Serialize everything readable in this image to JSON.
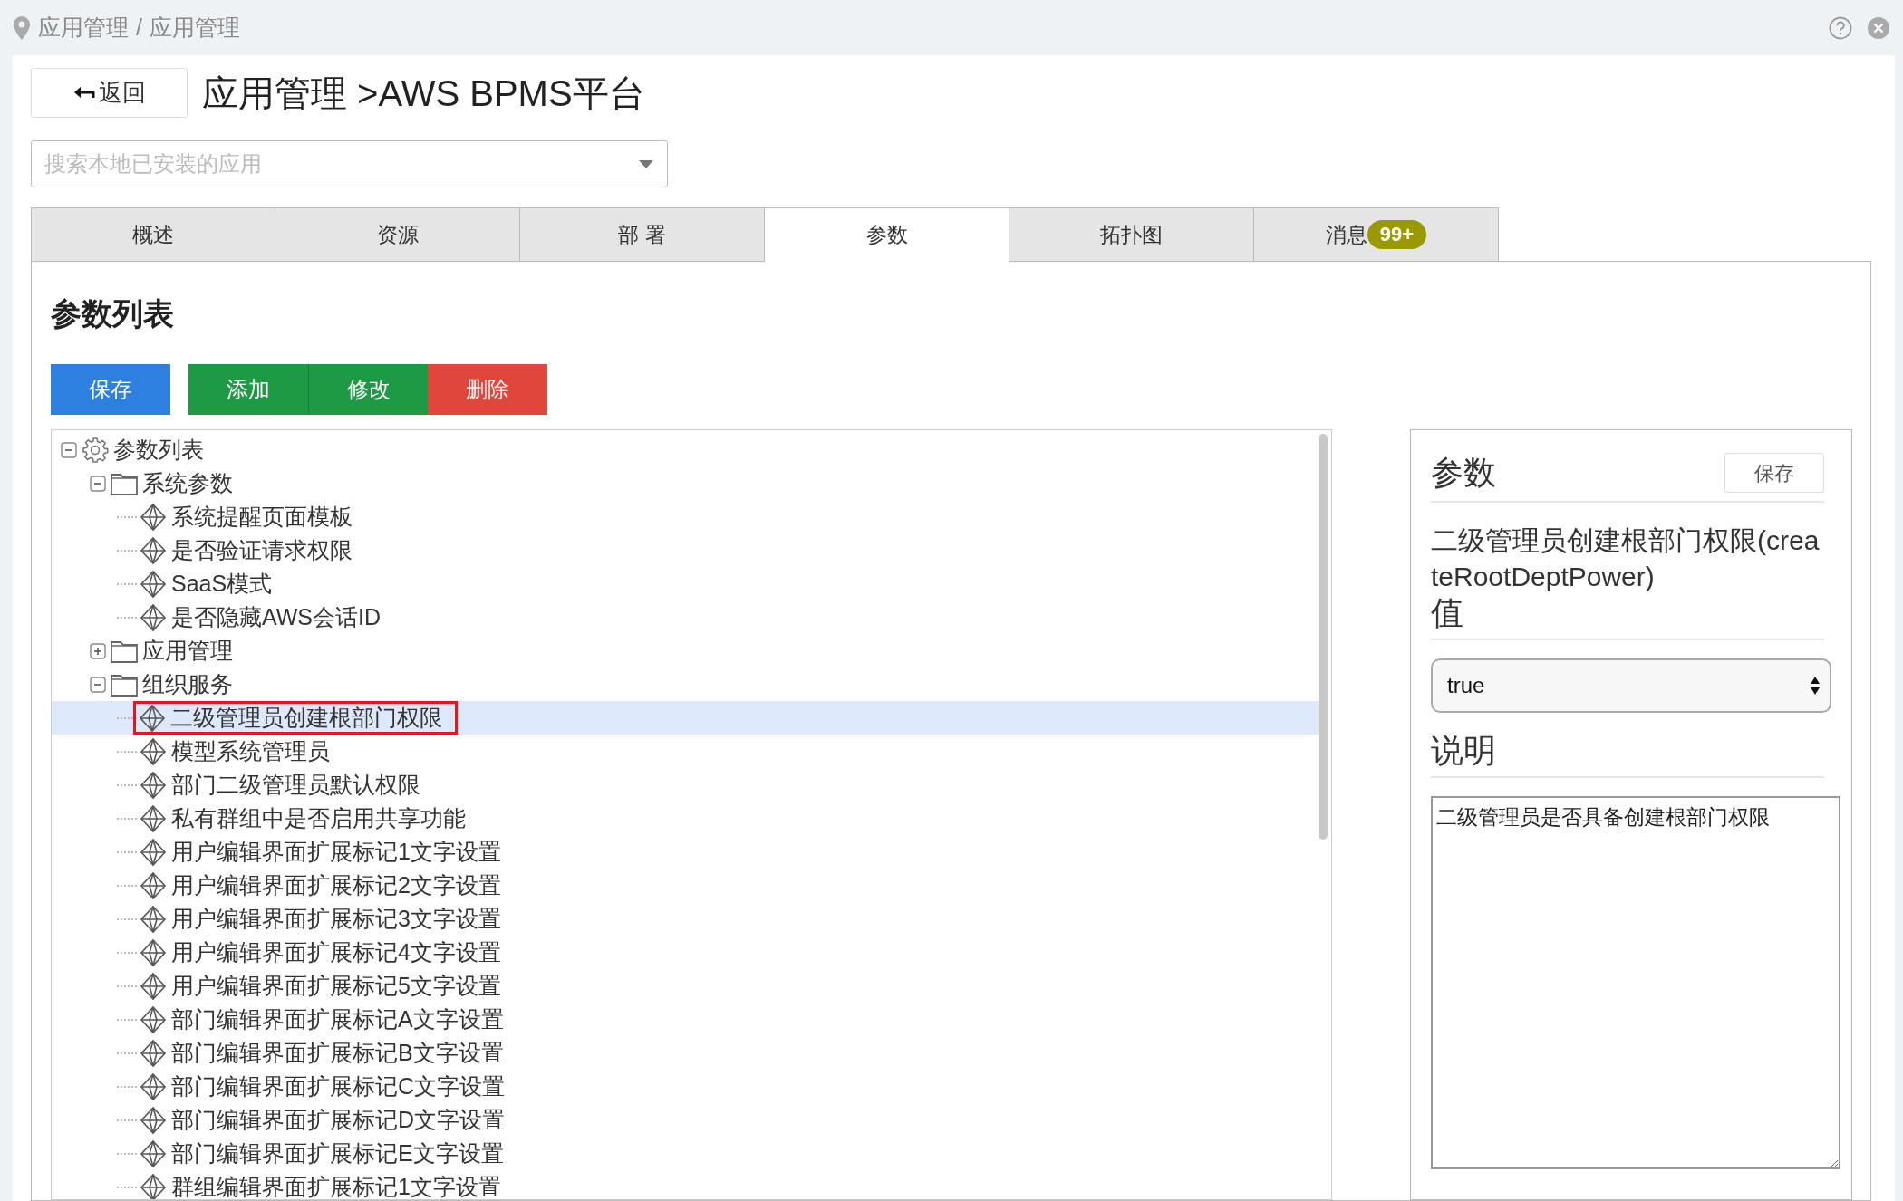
{
  "breadcrumb": {
    "items": [
      "应用管理",
      "应用管理"
    ],
    "separator": "/"
  },
  "back_button": "返回",
  "title": "应用管理 >AWS BPMS平台",
  "app_search": {
    "placeholder": "搜索本地已安装的应用"
  },
  "tabs": [
    {
      "label": "概述",
      "selected": false
    },
    {
      "label": "资源",
      "selected": false
    },
    {
      "label": "部 署",
      "selected": false
    },
    {
      "label": "参数",
      "selected": true
    },
    {
      "label": "拓扑图",
      "selected": false
    },
    {
      "label": "消息",
      "selected": false,
      "badge": "99+"
    }
  ],
  "section_title": "参数列表",
  "toolbar": [
    {
      "label": "保存",
      "kind": "primary"
    },
    {
      "label": "添加",
      "kind": "success"
    },
    {
      "label": "修改",
      "kind": "success"
    },
    {
      "label": "删除",
      "kind": "danger"
    }
  ],
  "tree": {
    "label": "参数列表",
    "kind": "root",
    "expanded": true,
    "selected": false,
    "children": [
      {
        "label": "系统参数",
        "kind": "folder",
        "expanded": true,
        "selected": false,
        "children": [
          {
            "label": "系统提醒页面模板",
            "kind": "param",
            "selected": false
          },
          {
            "label": "是否验证请求权限",
            "kind": "param",
            "selected": false
          },
          {
            "label": "SaaS模式",
            "kind": "param",
            "selected": false
          },
          {
            "label": "是否隐藏AWS会话ID",
            "kind": "param",
            "selected": false
          }
        ]
      },
      {
        "label": "应用管理",
        "kind": "folder",
        "expanded": false,
        "selected": false
      },
      {
        "label": "组织服务",
        "kind": "folder",
        "expanded": true,
        "selected": false,
        "children": [
          {
            "label": "二级管理员创建根部门权限",
            "kind": "param",
            "selected": true
          },
          {
            "label": "模型系统管理员",
            "kind": "param",
            "selected": false
          },
          {
            "label": "部门二级管理员默认权限",
            "kind": "param",
            "selected": false
          },
          {
            "label": "私有群组中是否启用共享功能",
            "kind": "param",
            "selected": false
          },
          {
            "label": "用户编辑界面扩展标记1文字设置",
            "kind": "param",
            "selected": false
          },
          {
            "label": "用户编辑界面扩展标记2文字设置",
            "kind": "param",
            "selected": false
          },
          {
            "label": "用户编辑界面扩展标记3文字设置",
            "kind": "param",
            "selected": false
          },
          {
            "label": "用户编辑界面扩展标记4文字设置",
            "kind": "param",
            "selected": false
          },
          {
            "label": "用户编辑界面扩展标记5文字设置",
            "kind": "param",
            "selected": false
          },
          {
            "label": "部门编辑界面扩展标记A文字设置",
            "kind": "param",
            "selected": false
          },
          {
            "label": "部门编辑界面扩展标记B文字设置",
            "kind": "param",
            "selected": false
          },
          {
            "label": "部门编辑界面扩展标记C文字设置",
            "kind": "param",
            "selected": false
          },
          {
            "label": "部门编辑界面扩展标记D文字设置",
            "kind": "param",
            "selected": false
          },
          {
            "label": "部门编辑界面扩展标记E文字设置",
            "kind": "param",
            "selected": false
          },
          {
            "label": "群组编辑界面扩展标记1文字设置",
            "kind": "param",
            "selected": false
          }
        ]
      }
    ]
  },
  "detail": {
    "title": "参数",
    "save_button": "保存",
    "param_name": "二级管理员创建根部门权限(createRootDeptPower)",
    "value_label": "值",
    "value": "true",
    "description_label": "说明",
    "description": "二级管理员是否具备创建根部门权限"
  }
}
